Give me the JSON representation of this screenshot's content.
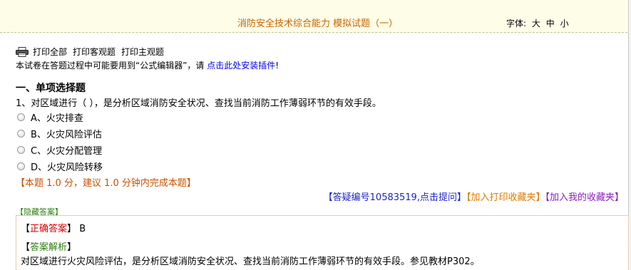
{
  "header": {
    "exam_title": "消防安全技术综合能力 模拟试题（一）",
    "font_label": "字体:",
    "font_large": "大",
    "font_medium": "中",
    "font_small": "小"
  },
  "print_bar": {
    "print_all": "打印全部",
    "print_objective": "打印客观题",
    "print_subjective": "打印主观题"
  },
  "notice": {
    "text_before": "本试卷在答题过程中可能要用到“公式编辑器”，请 ",
    "link": "点击此处安装插件",
    "text_after": "!"
  },
  "section": {
    "title": "一、单项选择题"
  },
  "question": {
    "text": "1、对区域进行（   ），是分析区域消防安全状况、查找当前消防工作薄弱环节的有效手段。",
    "options": [
      "A、火灾排查",
      "B、火灾风险评估",
      "C、火灾分配管理",
      "D、火灾风险转移"
    ],
    "hint": "【本题 1.0 分，建议 1.0 分钟内完成本题】"
  },
  "actions": {
    "ask": "【答疑编号10583519,点击提问】",
    "add_print_fav": "【加入打印收藏夹】",
    "add_my_fav": "【加入我的收藏夹】"
  },
  "answer": {
    "hide_label": "【隐藏答案】",
    "correct_open": "【",
    "correct_label": "正确答案",
    "correct_close": "】",
    "correct_value": "B",
    "analysis_open": "【",
    "analysis_label": "答案解析",
    "analysis_close": "】",
    "analysis_text": "对区域进行火灾风险评估，是分析区域消防安全状况、查找当前消防工作薄弱环节的有效手段。参见教材P302。"
  },
  "colors": {
    "title": "#c86400",
    "hint": "#c85000",
    "ask_link": "#1f25c8",
    "print_fav": "#e07b00",
    "my_fav": "#8a1fc0",
    "correct_label": "#d40000",
    "analysis_label": "#2e7d12"
  },
  "icons": {
    "printer": "printer-icon",
    "radio": "radio-button"
  }
}
